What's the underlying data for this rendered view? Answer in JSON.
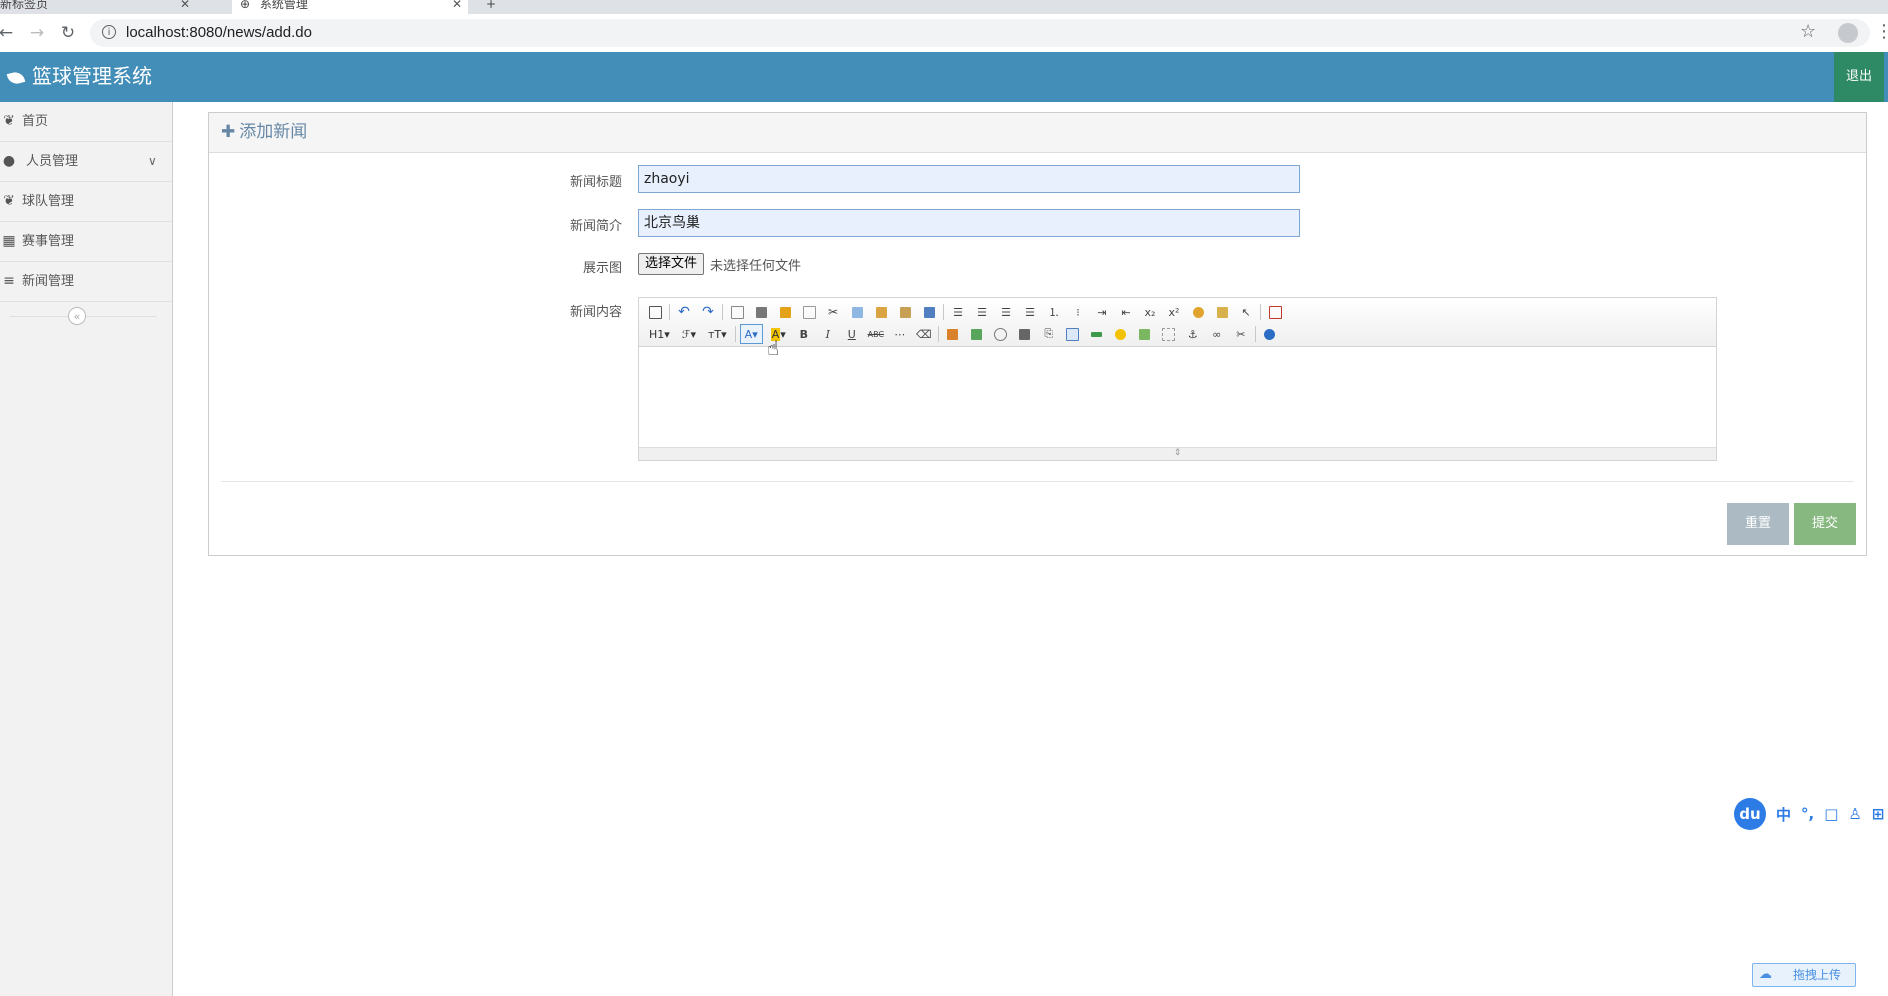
{
  "browser": {
    "tabs": [
      {
        "title": "新标签页"
      },
      {
        "title": "系统管理"
      }
    ],
    "url": "localhost:8080/news/add.do"
  },
  "app": {
    "title": "篮球管理系统",
    "logout_label": "退出"
  },
  "sidebar": {
    "items": [
      {
        "label": "首页",
        "icon": "leaf-icon"
      },
      {
        "label": "人员管理",
        "icon": "user-icon",
        "has_submenu": true
      },
      {
        "label": "球队管理",
        "icon": "leaf-icon"
      },
      {
        "label": "赛事管理",
        "icon": "calendar-icon"
      },
      {
        "label": "新闻管理",
        "icon": "list-icon"
      }
    ],
    "collapse_symbol": "«"
  },
  "form": {
    "heading": "添加新闻",
    "title_label": "新闻标题",
    "title_value": "zhaoyi",
    "summary_label": "新闻简介",
    "summary_value": "北京鸟巢",
    "image_label": "展示图",
    "file_button": "选择文件",
    "file_status": "未选择任何文件",
    "content_label": "新闻内容",
    "content_value": "",
    "editor_toolbar": {
      "heading_dropdown": "H1",
      "font_dropdown": "ℱ",
      "size_dropdown": "тT",
      "fore_color": "A",
      "back_color": "A"
    },
    "reset_label": "重置",
    "submit_label": "提交"
  },
  "ime": {
    "logo": "du",
    "items": [
      "中",
      "°,",
      "□",
      "♙",
      "⊞"
    ]
  },
  "upload_widget": {
    "label": "拖拽上传"
  },
  "colors": {
    "header": "#438eb9",
    "logout": "#2e8965",
    "reset": "#abbac3",
    "submit": "#87b87f"
  }
}
